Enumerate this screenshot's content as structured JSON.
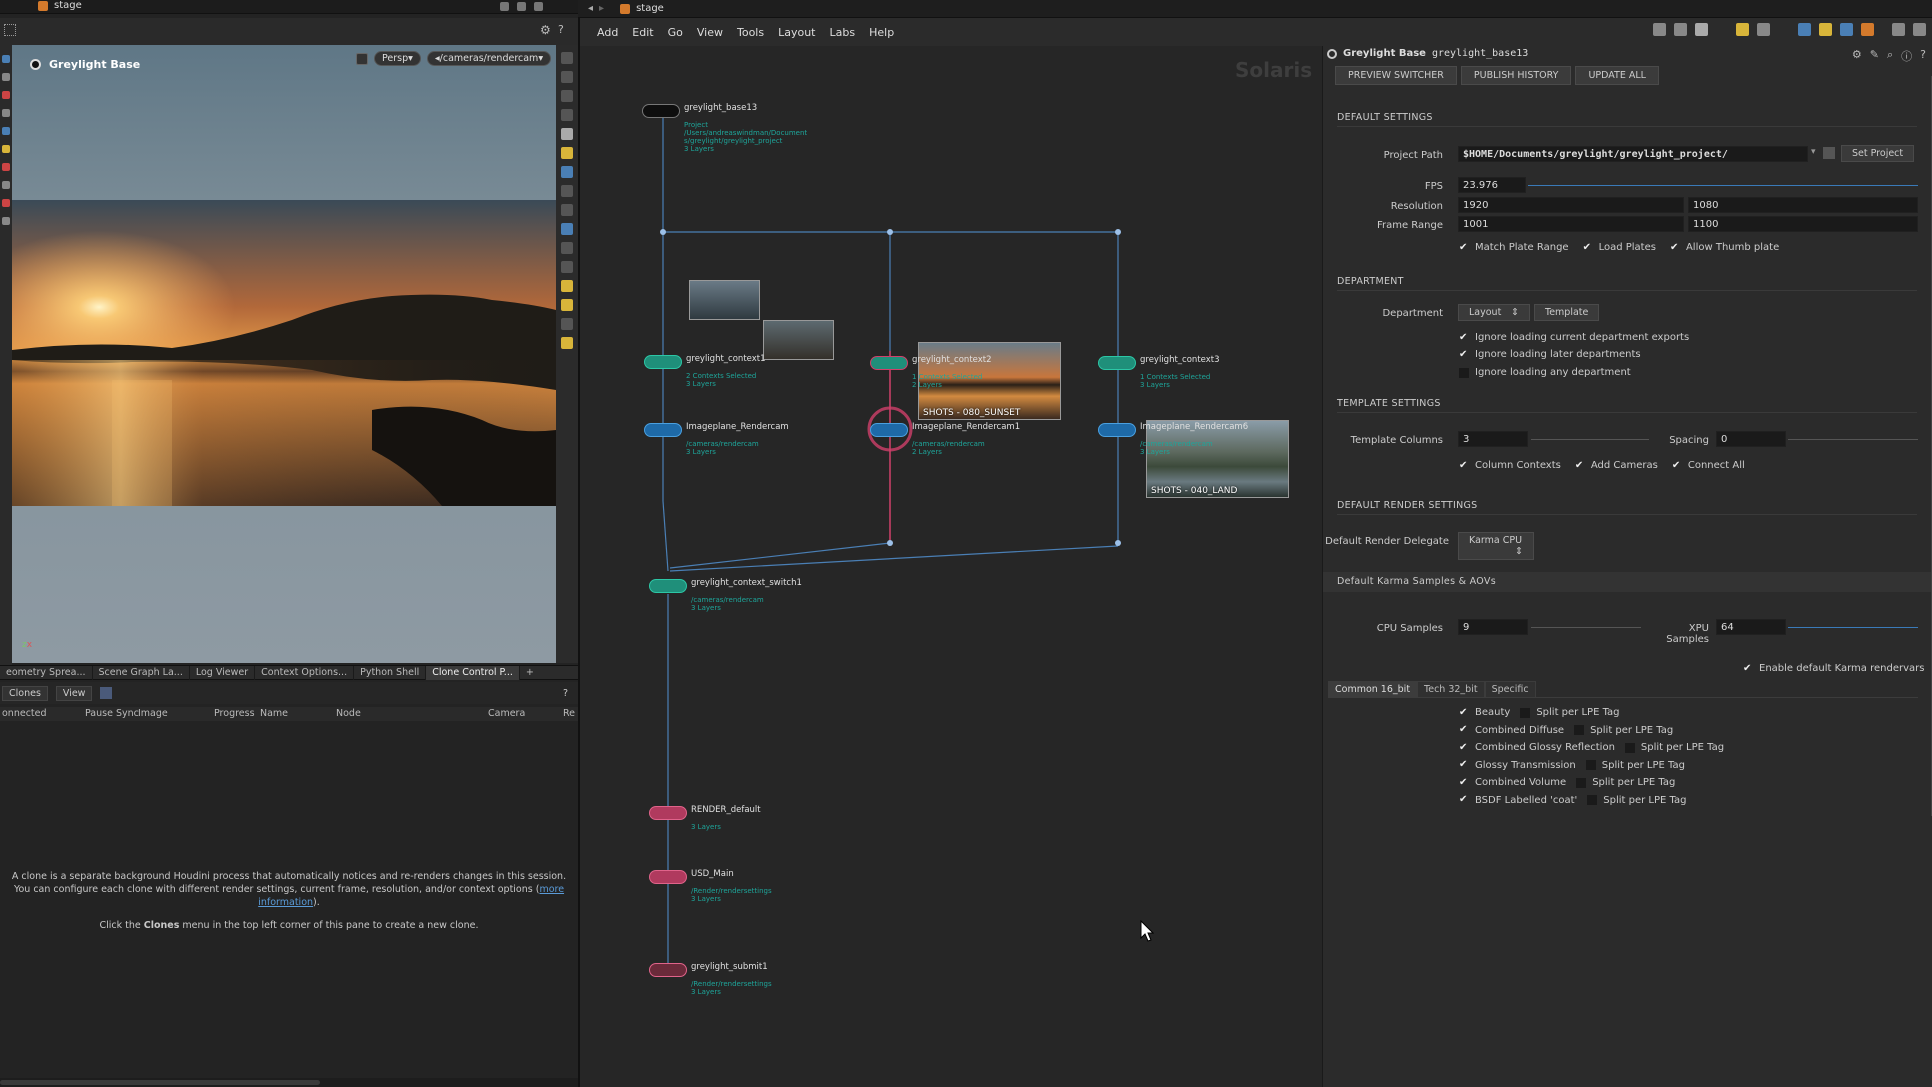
{
  "left_window": {
    "tab_title": "stage"
  },
  "right_window": {
    "tab_title": "stage"
  },
  "viewport": {
    "title": "Greylight Base",
    "persp_label": "Persp▾",
    "camera_label": "◂/cameras/rendercam▾"
  },
  "panel_tabs": [
    "eometry Sprea...",
    "Scene Graph La...",
    "Log Viewer",
    "Context Options...",
    "Python Shell",
    "Clone Control P..."
  ],
  "clones": {
    "clones_menu": "Clones",
    "view_menu": "View",
    "columns": [
      "onnected",
      "Pause Sync",
      "Image",
      "Progress",
      "Name",
      "Node",
      "Camera",
      "Re"
    ],
    "info_line1": "A clone is a separate background Houdini process that automatically notices and re-renders changes in this session.",
    "info_line2": "You can configure each clone with different render settings, current frame, resolution, and/or context options (",
    "info_link": "more information",
    "info_line2_end": ").",
    "info_line3_pre": "Click the ",
    "info_line3_bold": "Clones",
    "info_line3_post": " menu in the top left corner of this pane to create a new clone."
  },
  "menubar": [
    "Add",
    "Edit",
    "Go",
    "View",
    "Tools",
    "Layout",
    "Labs",
    "Help"
  ],
  "network": {
    "watermark": "Solaris",
    "nodes": {
      "base": {
        "name": "greylight_base13",
        "sub1": "Project",
        "sub2": "/Users/andreaswindman/Document",
        "sub3": "s/greylight/greylight_project",
        "sub4": "3 Layers"
      },
      "ctx1": {
        "name": "greylight_context1",
        "sub1": "2 Contexts Selected",
        "sub2": "3 Layers"
      },
      "ctx2": {
        "name": "greylight_context2",
        "sub1": "1 Contexts Selected",
        "sub2": "2 Layers"
      },
      "ctx3": {
        "name": "greylight_context3",
        "sub1": "1 Contexts Selected",
        "sub2": "3 Layers"
      },
      "cam1": {
        "name": "Imageplane_Rendercam",
        "sub1": "/cameras/rendercam",
        "sub2": "3 Layers"
      },
      "cam2": {
        "name": "Imageplane_Rendercam1",
        "sub1": "/cameras/rendercam",
        "sub2": "2 Layers"
      },
      "cam3": {
        "name": "Imageplane_Rendercam6",
        "sub1": "/cameras/rendercam",
        "sub2": "3 Layers"
      },
      "switch": {
        "name": "greylight_context_switch1",
        "sub1": "/cameras/rendercam",
        "sub2": "3 Layers"
      },
      "render": {
        "name": "RENDER_default",
        "sub2": "3 Layers"
      },
      "usd": {
        "name": "USD_Main",
        "sub1": "/Render/rendersettings",
        "sub2": "3 Layers"
      },
      "submit": {
        "name": "greylight_submit1",
        "sub1": "/Render/rendersettings",
        "sub2": "3 Layers"
      }
    },
    "thumbs": {
      "sunset": "SHOTS - 080_SUNSET",
      "land": "SHOTS - 040_LAND"
    }
  },
  "params": {
    "node_type": "Greylight Base",
    "node_name": "greylight_base13",
    "top_buttons": [
      "PREVIEW SWITCHER",
      "PUBLISH HISTORY",
      "UPDATE ALL"
    ],
    "default_settings": {
      "header": "DEFAULT SETTINGS",
      "project_path_label": "Project Path",
      "project_path": "$HOME/Documents/greylight/greylight_project/",
      "set_project": "Set Project",
      "fps_label": "FPS",
      "fps": "23.976",
      "resolution_label": "Resolution",
      "res_w": "1920",
      "res_h": "1080",
      "frame_range_label": "Frame Range",
      "frame_start": "1001",
      "frame_end": "1100",
      "checks": [
        "Match Plate Range",
        "Load Plates",
        "Allow Thumb plate"
      ]
    },
    "department": {
      "header": "DEPARTMENT",
      "label": "Department",
      "value": "Layout",
      "template_btn": "Template",
      "checks": [
        {
          "label": "Ignore loading current department exports",
          "checked": true
        },
        {
          "label": "Ignore loading later departments",
          "checked": true
        },
        {
          "label": "Ignore loading any department",
          "checked": false
        }
      ]
    },
    "template": {
      "header": "TEMPLATE SETTINGS",
      "columns_label": "Template Columns",
      "columns": "3",
      "spacing_label": "Spacing",
      "spacing": "0",
      "checks": [
        "Column Contexts",
        "Add Cameras",
        "Connect All"
      ]
    },
    "render": {
      "header": "DEFAULT RENDER SETTINGS",
      "delegate_label": "Default Render Delegate",
      "delegate": "Karma CPU"
    },
    "karma": {
      "header": "Default Karma Samples & AOVs",
      "cpu_label": "CPU Samples",
      "cpu": "9",
      "xpu_label": "XPU Samples",
      "xpu": "64",
      "enable_label": "Enable default Karma rendervars",
      "subtabs": [
        "Common 16_bit",
        "Tech 32_bit",
        "Specific"
      ],
      "aovs": [
        {
          "name": "Beauty",
          "split": "Split per LPE Tag"
        },
        {
          "name": "Combined Diffuse",
          "split": "Split per LPE Tag"
        },
        {
          "name": "Combined Glossy Reflection",
          "split": "Split per LPE Tag"
        },
        {
          "name": "Glossy Transmission",
          "split": "Split per LPE Tag"
        },
        {
          "name": "Combined Volume",
          "split": "Split per LPE Tag"
        },
        {
          "name": "BSDF Labelled 'coat'",
          "split": "Split per LPE Tag"
        }
      ]
    }
  }
}
